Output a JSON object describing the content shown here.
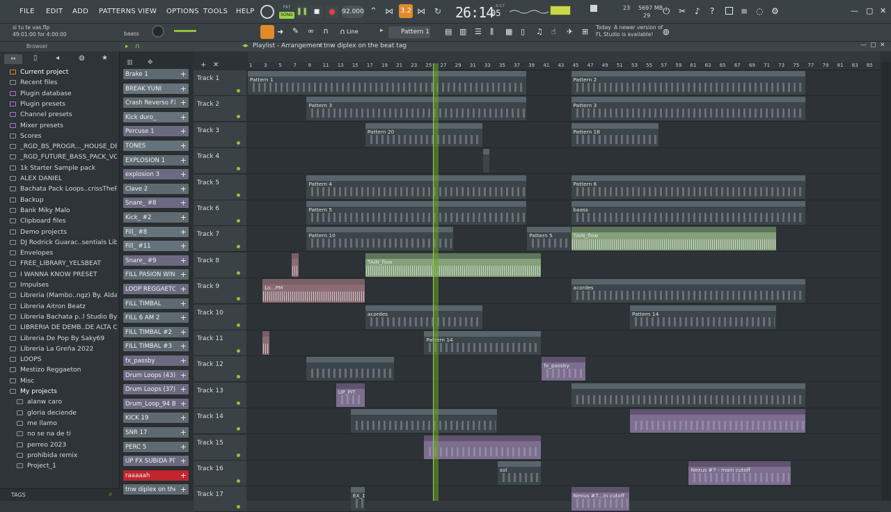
{
  "menu": {
    "file": "FILE",
    "edit": "EDIT",
    "add": "ADD",
    "patterns": "PATTERNS",
    "view": "VIEW",
    "options": "OPTIONS",
    "tools": "TOOLS",
    "help": "HELP"
  },
  "transport": {
    "mode_label": "SONG",
    "mode_top": "PAT",
    "tempo": "92.000",
    "time": "26:14",
    "time_sub": "05",
    "time_unit": "B:S:T",
    "pattern_num": "3.2",
    "cpu": "23",
    "mem": "5697 MB",
    "voices": "29"
  },
  "project": {
    "file": "si tu te vas.flp",
    "elapsed": "49:01:00 for 4:00:00",
    "channel_name": "baass"
  },
  "toolbar": {
    "snap": "Line",
    "pattern": "Pattern 1",
    "news_day": "Today",
    "news_text": "A newer version of",
    "news_text2": "FL Studio is available!"
  },
  "browser": {
    "title": "Browser",
    "tags": "TAGS",
    "items": [
      {
        "label": "Current project",
        "type": "current"
      },
      {
        "label": "Recent files",
        "type": "folder"
      },
      {
        "label": "Plugin database",
        "type": "plugin"
      },
      {
        "label": "Plugin presets",
        "type": "plugin"
      },
      {
        "label": "Channel presets",
        "type": "plugin"
      },
      {
        "label": "Mixer presets",
        "type": "plugin"
      },
      {
        "label": "Scores",
        "type": "note"
      },
      {
        "label": "_RGD_BS_PROGR..._HOUSE_DRUMKIT",
        "type": "folder"
      },
      {
        "label": "_RGD_FUTURE_BASS_PACK_VOL.4",
        "type": "folder"
      },
      {
        "label": "1k Starter Sample pack",
        "type": "folder"
      },
      {
        "label": "ALEX DANIEL",
        "type": "folder"
      },
      {
        "label": "Bachata Pack Loops..crissTheProducer",
        "type": "folder"
      },
      {
        "label": "Backup",
        "type": "folder"
      },
      {
        "label": "Bank Miky Malo",
        "type": "folder"
      },
      {
        "label": "Clipboard files",
        "type": "folder"
      },
      {
        "label": "Demo projects",
        "type": "folder"
      },
      {
        "label": "DJ Rodrick Guarac..sentials Libs Vol.1",
        "type": "folder"
      },
      {
        "label": "Envelopes",
        "type": "folder"
      },
      {
        "label": "FREE_LIBRARY_YELSBEAT",
        "type": "folder"
      },
      {
        "label": "I WANNA KNOW PRESET",
        "type": "folder"
      },
      {
        "label": "Impulses",
        "type": "folder"
      },
      {
        "label": "Libreria (Mambo..ngz) By. AldaNauw",
        "type": "folder"
      },
      {
        "label": "Libreria Aitron Beatz",
        "type": "folder"
      },
      {
        "label": "Libreria Bachata p..l Studio By Saky69",
        "type": "folder"
      },
      {
        "label": "LIBRERIA DE DEMB..DE ALTA CALIDAD",
        "type": "folder"
      },
      {
        "label": "Libreria De Pop By Saky69",
        "type": "folder"
      },
      {
        "label": "Libreria La Greña 2022",
        "type": "folder"
      },
      {
        "label": "LOOPS",
        "type": "folder"
      },
      {
        "label": "Mestizo Reggaeton",
        "type": "folder"
      },
      {
        "label": "Misc",
        "type": "folder"
      },
      {
        "label": "My projects",
        "type": "open"
      },
      {
        "label": "alanw caro",
        "type": "sub"
      },
      {
        "label": "gloria deciende",
        "type": "sub"
      },
      {
        "label": "me llamo",
        "type": "sub"
      },
      {
        "label": "no se na de ti",
        "type": "sub"
      },
      {
        "label": "perreo 2023",
        "type": "sub"
      },
      {
        "label": "prohibida remix",
        "type": "sub"
      },
      {
        "label": "Project_1",
        "type": "sub"
      }
    ]
  },
  "channels": [
    {
      "label": "Brake 1",
      "color": "#5f6a70"
    },
    {
      "label": "BREAK YUNI",
      "color": "#67737a"
    },
    {
      "label": "Crash Reverso FX - P...",
      "color": "#5f6a70"
    },
    {
      "label": "Kick duro_",
      "color": "#67737a"
    },
    {
      "label": "Percuse 1",
      "color": "#6c6a80"
    },
    {
      "label": "TONES",
      "color": "#67737a"
    },
    {
      "label": "EXPLOSION 1",
      "color": "#5f6a70"
    },
    {
      "label": "explosion 3",
      "color": "#6c6a80"
    },
    {
      "label": "Clave 2",
      "color": "#5f6a70"
    },
    {
      "label": "Snare_ #8",
      "color": "#6c6a80"
    },
    {
      "label": "Kick_ #2",
      "color": "#5f6a70"
    },
    {
      "label": "Fill_ #8",
      "color": "#67737a"
    },
    {
      "label": "Fill_ #11",
      "color": "#67737a"
    },
    {
      "label": "Snare_ #9",
      "color": "#6c6a80"
    },
    {
      "label": "FILL PASION WINE",
      "color": "#5f6a70"
    },
    {
      "label": "LOOP REGGAETON CO...",
      "color": "#6c6a80"
    },
    {
      "label": "FILL TIMBAL",
      "color": "#5f6a70"
    },
    {
      "label": "FILL 6 AM 2",
      "color": "#5f6a70"
    },
    {
      "label": "FILL TIMBAL #2",
      "color": "#5f6a70"
    },
    {
      "label": "FILL TIMBAL #3",
      "color": "#5f6a70"
    },
    {
      "label": "fx_passby",
      "color": "#6c6a80"
    },
    {
      "label": "Drum Loops (43)",
      "color": "#6c6a80"
    },
    {
      "label": "Drum Loops (37)",
      "color": "#6c6a80"
    },
    {
      "label": "Drum_Loop_94 Bpm",
      "color": "#6c6a80"
    },
    {
      "label": "KICK 19",
      "color": "#5f6a70"
    },
    {
      "label": "SNR 17",
      "color": "#5f6a70"
    },
    {
      "label": "PERC 5",
      "color": "#5f6a70"
    },
    {
      "label": "UP FX SUBIDA PIT",
      "color": "#6c6a80"
    },
    {
      "label": "raaaaah",
      "color": "#c0262d"
    },
    {
      "label": "tnw diplex on the be...",
      "color": "#5f6a70"
    }
  ],
  "playlist": {
    "title": "Playlist - Arrangement",
    "breadcrumb": "tnw diplex on the beat tag",
    "ruler": [
      "1",
      "3",
      "5",
      "7",
      "9",
      "11",
      "13",
      "15",
      "17",
      "19",
      "21",
      "23",
      "25",
      "27",
      "29",
      "31",
      "33",
      "35",
      "37",
      "39",
      "41",
      "43",
      "45",
      "47",
      "49",
      "51",
      "53",
      "55",
      "57",
      "59",
      "61",
      "63",
      "65",
      "67",
      "69",
      "71",
      "73",
      "75",
      "77",
      "79",
      "81",
      "83",
      "85"
    ],
    "tracks": [
      {
        "name": "Track 1",
        "clips": [
          {
            "s": 1,
            "l": 38,
            "t": "d",
            "n": "Pattern 1"
          },
          {
            "s": 45,
            "l": 32,
            "t": "d",
            "n": "Pattern 2"
          }
        ]
      },
      {
        "name": "Track 2",
        "clips": [
          {
            "s": 9,
            "l": 30,
            "t": "d",
            "n": "Pattern 3"
          },
          {
            "s": 45,
            "l": 32,
            "t": "d",
            "n": "Pattern 3"
          }
        ]
      },
      {
        "name": "Track 3",
        "clips": [
          {
            "s": 17,
            "l": 16,
            "t": "d",
            "n": "Pattern 20"
          },
          {
            "s": 45,
            "l": 12,
            "t": "d",
            "n": "Pattern 18"
          }
        ]
      },
      {
        "name": "Track 4",
        "clips": [
          {
            "s": 33,
            "l": 1,
            "t": "d",
            "n": ""
          }
        ]
      },
      {
        "name": "Track 5",
        "clips": [
          {
            "s": 9,
            "l": 30,
            "t": "d",
            "n": "Pattern 4"
          },
          {
            "s": 45,
            "l": 32,
            "t": "d",
            "n": "Pattern 6"
          }
        ]
      },
      {
        "name": "Track 6",
        "clips": [
          {
            "s": 9,
            "l": 30,
            "t": "d",
            "n": "Pattern 5"
          },
          {
            "s": 45,
            "l": 32,
            "t": "d",
            "n": "baass"
          }
        ]
      },
      {
        "name": "Track 7",
        "clips": [
          {
            "s": 9,
            "l": 20,
            "t": "d",
            "n": "Pattern 10"
          },
          {
            "s": 39,
            "l": 6,
            "t": "d",
            "n": "Pattern 5"
          },
          {
            "s": 45,
            "l": 28,
            "t": "g",
            "n": "TAIN_flow"
          }
        ]
      },
      {
        "name": "Track 8",
        "clips": [
          {
            "s": 17,
            "l": 24,
            "t": "g",
            "n": "TAIN_flow"
          },
          {
            "s": 7,
            "l": 1,
            "t": "p",
            "n": ""
          }
        ]
      },
      {
        "name": "Track 9",
        "clips": [
          {
            "s": 3,
            "l": 14,
            "t": "p",
            "n": "Lo...PM"
          },
          {
            "s": 45,
            "l": 32,
            "t": "d",
            "n": "acordes"
          }
        ]
      },
      {
        "name": "Track 10",
        "clips": [
          {
            "s": 17,
            "l": 16,
            "t": "d",
            "n": "acordes"
          },
          {
            "s": 53,
            "l": 20,
            "t": "d",
            "n": "Pattern 14"
          }
        ]
      },
      {
        "name": "Track 11",
        "clips": [
          {
            "s": 25,
            "l": 16,
            "t": "d",
            "n": "Pattern 14"
          },
          {
            "s": 3,
            "l": 1,
            "t": "p",
            "n": ""
          }
        ]
      },
      {
        "name": "Track 12",
        "clips": [
          {
            "s": 9,
            "l": 12,
            "t": "d",
            "n": ""
          },
          {
            "s": 41,
            "l": 6,
            "t": "pu",
            "n": "fx_passby"
          }
        ]
      },
      {
        "name": "Track 13",
        "clips": [
          {
            "s": 13,
            "l": 4,
            "t": "pu",
            "n": "UP_PIT"
          },
          {
            "s": 45,
            "l": 32,
            "t": "d",
            "n": ""
          }
        ]
      },
      {
        "name": "Track 14",
        "clips": [
          {
            "s": 15,
            "l": 20,
            "t": "d",
            "n": ""
          },
          {
            "s": 53,
            "l": 24,
            "t": "pu",
            "n": ""
          }
        ]
      },
      {
        "name": "Track 15",
        "clips": [
          {
            "s": 25,
            "l": 16,
            "t": "pu",
            "n": ""
          }
        ]
      },
      {
        "name": "Track 16",
        "clips": [
          {
            "s": 35,
            "l": 6,
            "t": "d",
            "n": "sol"
          },
          {
            "s": 61,
            "l": 14,
            "t": "pu",
            "n": "Nexus #7 - main cutoff"
          }
        ]
      },
      {
        "name": "Track 17",
        "clips": [
          {
            "s": 15,
            "l": 2,
            "t": "d",
            "n": "EX_1"
          },
          {
            "s": 45,
            "l": 8,
            "t": "pu",
            "n": "Nexus #7...in cutoff"
          }
        ]
      }
    ]
  }
}
